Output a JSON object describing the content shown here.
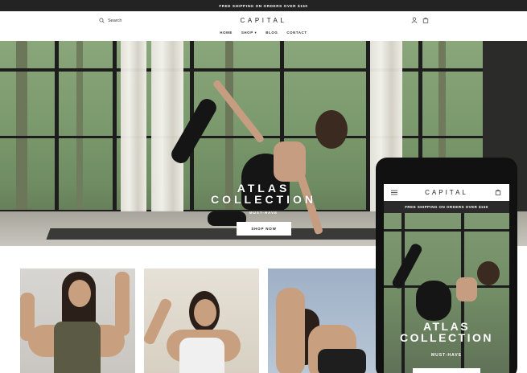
{
  "announcement": {
    "text": "FREE SHIPPING ON ORDERS OVER $150"
  },
  "header": {
    "search_label": "Search",
    "logo": "CAPITAL",
    "nav": [
      {
        "label": "HOME"
      },
      {
        "label": "SHOP ▾"
      },
      {
        "label": "BLOG"
      },
      {
        "label": "CONTACT"
      }
    ],
    "icons": [
      "account-icon",
      "cart-icon"
    ]
  },
  "hero": {
    "title_line1": "ATLAS",
    "title_line2": "COLLECTION",
    "subtitle": "MUST-HAVE",
    "cta_label": "SHOP NOW"
  },
  "products": [
    {
      "name": "product-tile-1"
    },
    {
      "name": "product-tile-2"
    },
    {
      "name": "product-tile-3"
    }
  ],
  "mobile": {
    "logo": "CAPITAL",
    "announcement": "FREE SHIPPING ON ORDERS OVER $150",
    "title_line1": "ATLAS",
    "title_line2": "COLLECTION",
    "subtitle": "MUST-HAVE",
    "icons": [
      "menu-icon",
      "bag-icon"
    ]
  },
  "colors": {
    "announcement_bg": "#232323",
    "page_bg": "#ffffff",
    "cta_bg": "#ffffff",
    "phone_frame": "#111111"
  }
}
